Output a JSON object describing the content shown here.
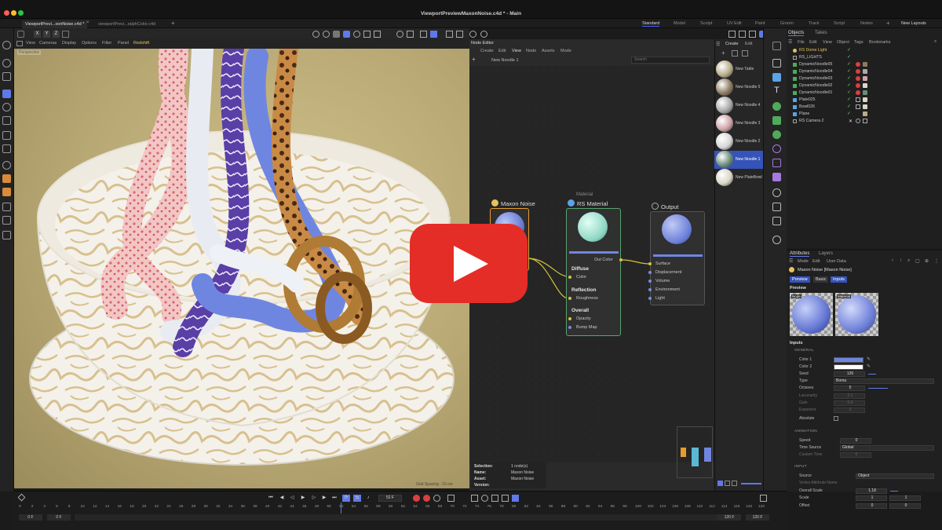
{
  "window": {
    "title": "ViewportPreviewMaxonNoise.c4d * - Main",
    "doc_tabs": [
      "ViewportPrevi...xonNoise.c4d *",
      "viewportPrevi...ralphColor.c4d"
    ],
    "layouts": [
      "Standard",
      "Model",
      "Sculpt",
      "UV Edit",
      "Paint",
      "Groom",
      "Track",
      "Script",
      "Nodes"
    ],
    "active_layout": "Standard",
    "new_layouts": "New Layouts",
    "axis_buttons": [
      "X",
      "Y",
      "Z"
    ]
  },
  "viewport": {
    "menu": [
      "View",
      "Cameras",
      "Display",
      "Options",
      "Filter",
      "Panel",
      "Redshift"
    ],
    "label": "Perspective",
    "grid_spacing": "Grid Spacing : 10 cm"
  },
  "node_editor": {
    "title": "Node Editor",
    "menu": [
      "Create",
      "Edit",
      "View",
      "Node",
      "Assets",
      "Mode"
    ],
    "breadcrumb": "New Noodle 1",
    "search_placeholder": "Search",
    "nodes": {
      "noise": {
        "title": "Maxon Noise"
      },
      "material": {
        "group_label": "Material",
        "title": "RS Material",
        "out_port": "Out Color",
        "diffuse": "Diffuse",
        "color": "Color",
        "reflection": "Reflection",
        "roughness": "Roughness",
        "overall": "Overall",
        "opacity": "Opacity",
        "bump": "Bump Map"
      },
      "output": {
        "title": "Output",
        "ports": [
          "Surface",
          "Displacement",
          "Volume",
          "Environment",
          "Light"
        ]
      }
    },
    "info": {
      "selection_label": "Selection:",
      "selection_value": "1 node(s)",
      "name_label": "Name:",
      "name_value": "Maxon Noise",
      "asset_label": "Asset:",
      "asset_value": "Maxon Noise",
      "version_label": "Version:",
      "version_value": ""
    }
  },
  "material_list": {
    "header": [
      "Create",
      "Edit"
    ],
    "items": [
      {
        "name": "New Table",
        "color": "#b8ad8a"
      },
      {
        "name": "New Noodle 5",
        "color": "#8c7a62"
      },
      {
        "name": "New Noodle 4",
        "color": "#a8a8a8"
      },
      {
        "name": "New Noodle 3",
        "color": "#cfa2a6"
      },
      {
        "name": "New Noodle 2",
        "color": "#d6d6d6"
      },
      {
        "name": "New Noodle 1",
        "color": "#6b8c7a"
      },
      {
        "name": "New PlateBowl",
        "color": "#dad5c5"
      }
    ],
    "selected_index": 5
  },
  "objects": {
    "tabs": [
      "Objects",
      "Takes"
    ],
    "menu": [
      "File",
      "Edit",
      "View",
      "Object",
      "Tags",
      "Bookmarks"
    ],
    "items": [
      "RS Dome Light",
      "RS_LIGHTS",
      "DynamicNoodle05",
      "DynamicNoodle04",
      "DynamicNoodle03",
      "DynamicNoodle02",
      "DynamicNoodle01",
      "Plate025",
      "Bowl026",
      "Plane",
      "RS Camera 2"
    ]
  },
  "attributes": {
    "tabs": [
      "Attributes",
      "Layers"
    ],
    "menu": [
      "Mode",
      "Edit",
      "User Data"
    ],
    "node_title": "Maxon Noise [Maxon Noise]",
    "subtabs": [
      "Preview",
      "Basic",
      "Inputs"
    ],
    "preview_label": "Preview",
    "preview_thumbs": [
      "Node",
      "Material"
    ],
    "inputs_label": "Inputs",
    "general_header": "GENERAL",
    "color1_label": "Color 1",
    "color1_hex": "#6f86e0",
    "color2_label": "Color 2",
    "color2_hex": "#ffffff",
    "seed_label": "Seed",
    "seed_value": "126",
    "type_label": "Type",
    "type_value": "Boma",
    "octaves_label": "Octaves",
    "octaves_value": "5",
    "lacunarity_label": "Lacunarity",
    "lacunarity_value": "2.1",
    "gain_label": "Gain",
    "gain_value": "0.6",
    "exponent_label": "Exponent",
    "exponent_value": "2",
    "absolute_label": "Absolute",
    "animation_header": "ANIMATION",
    "speed_label": "Speed",
    "speed_value": "0",
    "time_source_label": "Time Source",
    "time_source_value": "Global",
    "custom_time_label": "Custom Time",
    "custom_time_value": "0",
    "input_header": "INPUT",
    "source_label": "Source",
    "source_value": "Object",
    "vertex_attr_label": "Vertex Attribute Name",
    "overall_scale_label": "Overall Scale",
    "overall_scale_value": "1.18",
    "scale_label": "Scale",
    "scale_x": "1",
    "scale_y": "1",
    "offset_label": "Offset",
    "offset_x": "0",
    "offset_y": "0"
  },
  "timeline": {
    "ticks": [
      "0",
      "2",
      "4",
      "6",
      "8",
      "10",
      "12",
      "14",
      "16",
      "18",
      "20",
      "22",
      "24",
      "26",
      "28",
      "30",
      "32",
      "34",
      "36",
      "38",
      "40",
      "42",
      "44",
      "46",
      "48",
      "50",
      "52",
      "54",
      "56",
      "58",
      "60",
      "62",
      "64",
      "66",
      "68",
      "70",
      "72",
      "74",
      "76",
      "78",
      "80",
      "82",
      "84",
      "86",
      "88",
      "90",
      "92",
      "94",
      "96",
      "98",
      "100",
      "102",
      "104",
      "106",
      "108",
      "110",
      "112",
      "114",
      "116",
      "118",
      "120"
    ],
    "current_frame": "52 F",
    "start_frame": "0 F",
    "start_frame2": "0 F",
    "end_frame": "120 F",
    "end_frame2": "120 F"
  }
}
